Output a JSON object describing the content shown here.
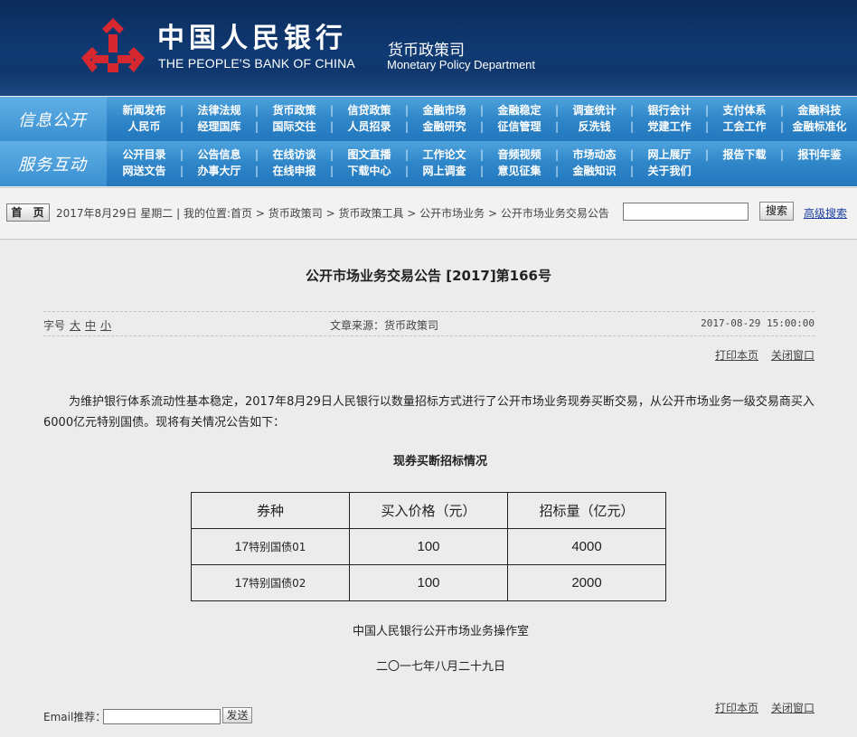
{
  "header": {
    "bank_name_cn": "中国人民银行",
    "bank_name_en": "THE PEOPLE'S BANK OF CHINA",
    "dept_cn": "货币政策司",
    "dept_en": "Monetary Policy Department",
    "logo_icon": "pboc-logo-icon",
    "logo_color": "#d8282f"
  },
  "nav_info": {
    "section_label": "信息公开",
    "row1": [
      "新闻发布",
      "法律法规",
      "货币政策",
      "信贷政策",
      "金融市场",
      "金融稳定",
      "调查统计",
      "银行会计",
      "支付体系",
      "金融科技"
    ],
    "row2": [
      "人民币",
      "经理国库",
      "国际交往",
      "人员招录",
      "金融研究",
      "征信管理",
      "反洗钱",
      "党建工作",
      "工会工作",
      "金融标准化"
    ]
  },
  "nav_service": {
    "section_label": "服务互动",
    "row1": [
      "公开目录",
      "公告信息",
      "在线访谈",
      "图文直播",
      "工作论文",
      "音频视频",
      "市场动态",
      "网上展厅",
      "报告下载",
      "报刊年鉴"
    ],
    "row2": [
      "网送文告",
      "办事大厅",
      "在线申报",
      "下载中心",
      "网上调查",
      "意见征集",
      "金融知识",
      "关于我们"
    ]
  },
  "locbar": {
    "home_label": "首 页",
    "date_text": "2017年8月29日",
    "weekday_text": "星期二",
    "location_prefix": "我的位置:",
    "crumbs": [
      "首页",
      "货币政策司",
      "货币政策工具",
      "公开市场业务",
      "公开市场业务交易公告"
    ],
    "search_placeholder": "",
    "search_label": "搜索",
    "advanced_search_label": "高级搜索"
  },
  "article": {
    "title": "公开市场业务交易公告 [2017]第166号",
    "font_size_label": "字号",
    "font_sizes": [
      "大",
      "中",
      "小"
    ],
    "source": "文章来源：货币政策司",
    "datetime": "2017-08-29 15:00:00",
    "print_label": "打印本页",
    "close_label": "关闭窗口",
    "paragraph": "为维护银行体系流动性基本稳定，2017年8月29日人民银行以数量招标方式进行了公开市场业务现券买断交易，从公开市场业务一级交易商买入6000亿元特别国债。现将有关情况公告如下：",
    "table_title": "现券买断招标情况",
    "table_headers": [
      "券种",
      "买入价格（元）",
      "招标量（亿元）"
    ],
    "table_rows": [
      {
        "bond_num": "17",
        "bond_name": "特别国债01",
        "price": "100",
        "volume": "4000"
      },
      {
        "bond_num": "17",
        "bond_name": "特别国债02",
        "price": "100",
        "volume": "2000"
      }
    ],
    "signature": "中国人民银行公开市场业务操作室",
    "sign_date": "二〇一七年八月二十九日"
  },
  "footer": {
    "email_label": "Email推荐：",
    "email_value": "",
    "send_label": "发送"
  }
}
